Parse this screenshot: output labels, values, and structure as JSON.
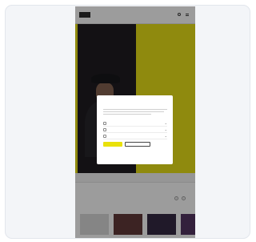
{
  "nav": {
    "links": [
      "",
      "",
      "",
      "",
      "",
      ""
    ],
    "logo_label": "logo"
  },
  "hero": {
    "number_rows": [
      "",
      "",
      "",
      "",
      "",
      "",
      "",
      ""
    ],
    "headline": ""
  },
  "tabs": [
    "",
    "",
    ""
  ],
  "section": {
    "title": "",
    "filters": "",
    "cards": [
      "",
      "",
      "",
      ""
    ]
  },
  "cookie_modal": {
    "title": "",
    "options": [
      "",
      "",
      ""
    ],
    "accept_label": "",
    "settings_label": "",
    "footer": ""
  },
  "colors": {
    "accent": "#e9e10b",
    "hero_dark": "#141015",
    "scrim": "rgba(20,20,20,0.42)"
  }
}
